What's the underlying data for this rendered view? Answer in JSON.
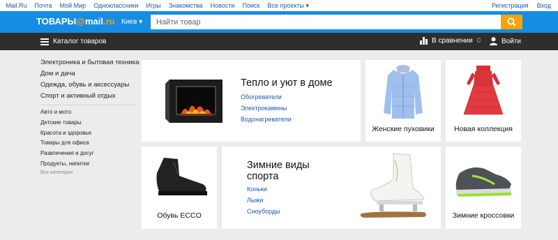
{
  "topbar": {
    "links": [
      "Mail.Ru",
      "Почта",
      "Мой Мир",
      "Одноклассники",
      "Игры",
      "Знакомства",
      "Новости",
      "Поиск",
      "Все проекты ▾"
    ],
    "register": "Регистрация",
    "login": "Вход"
  },
  "header": {
    "logo_text": "ТОВАРЫ",
    "logo_at": "@",
    "logo_mail": "mail",
    "logo_ru": ".ru",
    "city": "Киев ▾",
    "search_placeholder": "Найти товар"
  },
  "navbar": {
    "catalog": "Каталог товаров",
    "compare_label": "В сравнении",
    "compare_count": "0",
    "login": "Войти"
  },
  "sidebar": {
    "main": [
      "Электроника и бытовая техника",
      "Дом и дача",
      "Одежда, обувь и аксессуары",
      "Спорт и активный отдых"
    ],
    "secondary": [
      "Авто и мото",
      "Детские товары",
      "Красота и здоровье",
      "Товары для офиса",
      "Развлечения и досуг",
      "Продукты, напитки"
    ],
    "all": "Все категории"
  },
  "cards": {
    "warm": {
      "title": "Тепло и уют в доме",
      "links": [
        "Обогреватели",
        "Электрокамины",
        "Водонагреватели"
      ]
    },
    "jackets": {
      "caption": "Женские пуховики"
    },
    "collection": {
      "caption": "Новая коллекция"
    },
    "ecco": {
      "caption": "Обувь ECCO"
    },
    "winter": {
      "title_line1": "Зимние виды",
      "title_line2": "спорта",
      "links": [
        "Коньки",
        "Лыжи",
        "Сноуборды"
      ]
    },
    "sneakers": {
      "caption": "Зимние кроссовки"
    }
  },
  "colors": {
    "brand_blue": "#168de2",
    "search_orange": "#f5a40b",
    "dark_bar": "#2e2e2e",
    "link_blue": "#1a5aa8"
  }
}
